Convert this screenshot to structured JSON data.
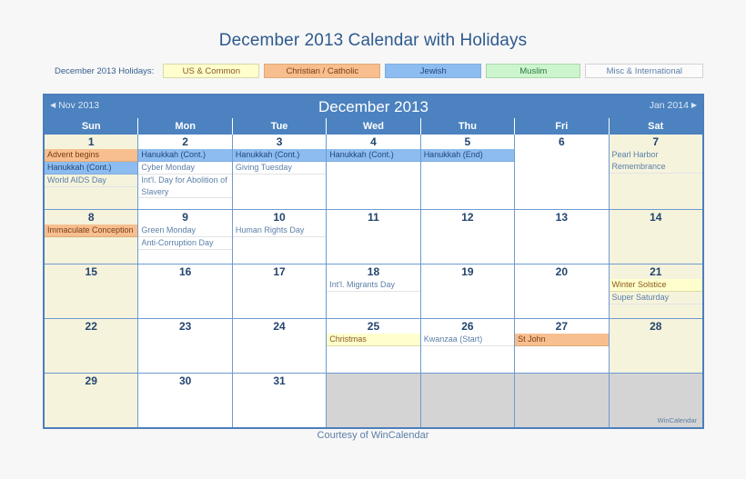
{
  "page": {
    "title": "December 2013 Calendar with Holidays",
    "footer": "Courtesy of WinCalendar",
    "watermark": "WinCalendar"
  },
  "legend": {
    "label": "December 2013 Holidays:",
    "items": [
      {
        "key": "us",
        "label": "US & Common",
        "color": "#ffffcd"
      },
      {
        "key": "chr",
        "label": "Christian / Catholic",
        "color": "#f7bf8f"
      },
      {
        "key": "jew",
        "label": "Jewish",
        "color": "#8cbcf0"
      },
      {
        "key": "mus",
        "label": "Muslim",
        "color": "#cdf5cd"
      },
      {
        "key": "misc",
        "label": "Misc & International",
        "color": "#fbfbfb"
      }
    ]
  },
  "calendar": {
    "prev_month": "Nov 2013",
    "month_title": "December 2013",
    "next_month": "Jan 2014",
    "weekdays": [
      "Sun",
      "Mon",
      "Tue",
      "Wed",
      "Thu",
      "Fri",
      "Sat"
    ],
    "weeks": [
      {
        "days": [
          {
            "num": "1",
            "weekend": true,
            "events": [
              {
                "text": "Advent begins",
                "cat": "chr"
              },
              {
                "text": "Hanukkah (Cont.)",
                "cat": "jew"
              },
              {
                "text": "World AIDS Day",
                "cat": "misc"
              }
            ]
          },
          {
            "num": "2",
            "weekend": false,
            "events": [
              {
                "text": "Hanukkah (Cont.)",
                "cat": "jew"
              },
              {
                "text": "Cyber Monday",
                "cat": "misc"
              },
              {
                "text": "Int'l. Day for Abolition of Slavery",
                "cat": "misc"
              }
            ]
          },
          {
            "num": "3",
            "weekend": false,
            "events": [
              {
                "text": "Hanukkah (Cont.)",
                "cat": "jew"
              },
              {
                "text": "Giving Tuesday",
                "cat": "misc"
              }
            ]
          },
          {
            "num": "4",
            "weekend": false,
            "events": [
              {
                "text": "Hanukkah (Cont.)",
                "cat": "jew"
              }
            ]
          },
          {
            "num": "5",
            "weekend": false,
            "events": [
              {
                "text": "Hanukkah (End)",
                "cat": "jew"
              }
            ]
          },
          {
            "num": "6",
            "weekend": false,
            "events": []
          },
          {
            "num": "7",
            "weekend": true,
            "events": [
              {
                "text": "Pearl Harbor Remembrance",
                "cat": "misc"
              }
            ]
          }
        ]
      },
      {
        "days": [
          {
            "num": "8",
            "weekend": true,
            "events": [
              {
                "text": "Immaculate Conception",
                "cat": "chr"
              }
            ]
          },
          {
            "num": "9",
            "weekend": false,
            "events": [
              {
                "text": "Green Monday",
                "cat": "misc"
              },
              {
                "text": "Anti-Corruption Day",
                "cat": "misc"
              }
            ]
          },
          {
            "num": "10",
            "weekend": false,
            "events": [
              {
                "text": "Human Rights Day",
                "cat": "misc"
              }
            ]
          },
          {
            "num": "11",
            "weekend": false,
            "events": []
          },
          {
            "num": "12",
            "weekend": false,
            "events": []
          },
          {
            "num": "13",
            "weekend": false,
            "events": []
          },
          {
            "num": "14",
            "weekend": true,
            "events": []
          }
        ]
      },
      {
        "days": [
          {
            "num": "15",
            "weekend": true,
            "events": []
          },
          {
            "num": "16",
            "weekend": false,
            "events": []
          },
          {
            "num": "17",
            "weekend": false,
            "events": []
          },
          {
            "num": "18",
            "weekend": false,
            "events": [
              {
                "text": "Int'l. Migrants Day",
                "cat": "misc"
              }
            ]
          },
          {
            "num": "19",
            "weekend": false,
            "events": []
          },
          {
            "num": "20",
            "weekend": false,
            "events": []
          },
          {
            "num": "21",
            "weekend": true,
            "events": [
              {
                "text": "Winter Solstice",
                "cat": "us"
              },
              {
                "text": "Super Saturday",
                "cat": "misc"
              }
            ]
          }
        ]
      },
      {
        "days": [
          {
            "num": "22",
            "weekend": true,
            "events": []
          },
          {
            "num": "23",
            "weekend": false,
            "events": []
          },
          {
            "num": "24",
            "weekend": false,
            "events": []
          },
          {
            "num": "25",
            "weekend": false,
            "events": [
              {
                "text": "Christmas",
                "cat": "us"
              }
            ]
          },
          {
            "num": "26",
            "weekend": false,
            "events": [
              {
                "text": "Kwanzaa (Start)",
                "cat": "misc"
              }
            ]
          },
          {
            "num": "27",
            "weekend": false,
            "events": [
              {
                "text": "St John",
                "cat": "chr"
              }
            ]
          },
          {
            "num": "28",
            "weekend": true,
            "events": []
          }
        ]
      },
      {
        "days": [
          {
            "num": "29",
            "weekend": true,
            "events": []
          },
          {
            "num": "30",
            "weekend": false,
            "events": []
          },
          {
            "num": "31",
            "weekend": false,
            "events": []
          },
          {
            "num": "",
            "weekend": false,
            "grayed": true,
            "events": []
          },
          {
            "num": "",
            "weekend": false,
            "grayed": true,
            "events": []
          },
          {
            "num": "",
            "weekend": false,
            "grayed": true,
            "events": []
          },
          {
            "num": "",
            "weekend": false,
            "grayed": true,
            "events": []
          }
        ]
      }
    ]
  }
}
